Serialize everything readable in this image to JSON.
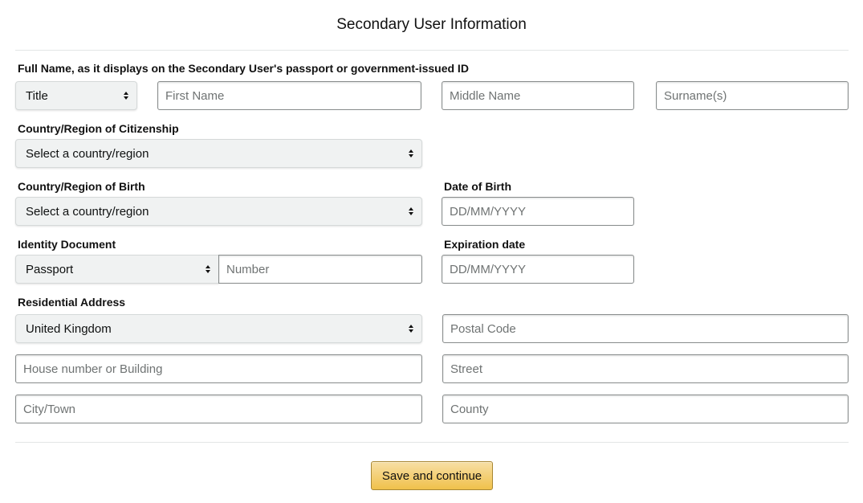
{
  "page": {
    "title": "Secondary User Information"
  },
  "full_name": {
    "label": "Full Name, as it displays on the Secondary User's passport or government-issued ID",
    "title_select": "Title",
    "first_name_placeholder": "First Name",
    "middle_name_placeholder": "Middle Name",
    "surname_placeholder": "Surname(s)"
  },
  "citizenship": {
    "label": "Country/Region of Citizenship",
    "select_value": "Select a country/region"
  },
  "birth": {
    "country_label": "Country/Region of Birth",
    "country_select": "Select a country/region",
    "date_label": "Date of Birth",
    "date_placeholder": "DD/MM/YYYY"
  },
  "identity": {
    "label": "Identity Document",
    "type_select": "Passport",
    "number_placeholder": "Number",
    "expiration_label": "Expiration date",
    "expiration_placeholder": "DD/MM/YYYY"
  },
  "address": {
    "label": "Residential Address",
    "country_select": "United Kingdom",
    "postal_code_placeholder": "Postal Code",
    "house_placeholder": "House number or Building",
    "street_placeholder": "Street",
    "city_placeholder": "City/Town",
    "county_placeholder": "County"
  },
  "actions": {
    "save_label": "Save and continue"
  },
  "colors": {
    "button_top": "#f7dfa5",
    "button_bottom": "#f0c14b",
    "button_border": "#a88734",
    "select_background": "#f0f2f2"
  },
  "icons": {
    "select_arrow": "sort-arrows-icon"
  }
}
